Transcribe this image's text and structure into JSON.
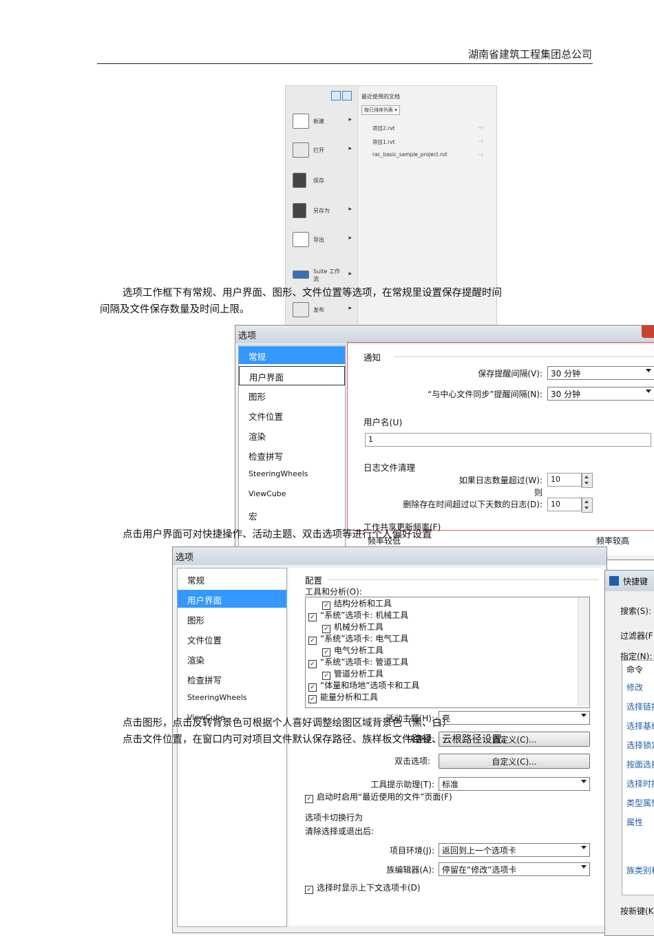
{
  "header": {
    "company": "湖南省建筑工程集团总公司"
  },
  "paragraphs": {
    "p1_line1": "选项工作框下有常规、用户界面、图形、文件位置等选项，在常规里设置保存提醒时间",
    "p1_line2": "间隔及文件保存数量及时间上限。",
    "p2": "点击用户界面可对快捷操作、活动主题、双击选项等进行个人偏好设置",
    "p3": "点击图形，点击反转背景色可根据个人喜好调整绘图区域背景色（黑、白）",
    "p4": "点击文件位置，在窗口内可对项目文件默认保存路径、族样板文件路径、云根路径设置。"
  },
  "app_menu": {
    "recent_title": "最近使用的文档",
    "sort_label": "按已排序列表",
    "items": [
      {
        "label": "新建",
        "arrow": "▸"
      },
      {
        "label": "打开",
        "arrow": "▸"
      },
      {
        "label": "保存",
        "arrow": ""
      },
      {
        "label": "另存为",
        "arrow": "▸"
      },
      {
        "label": "导出",
        "arrow": "▸"
      },
      {
        "label": "Suite 工作流",
        "arrow": "▸"
      },
      {
        "label": "发布",
        "arrow": "▸"
      }
    ],
    "recent_files": [
      "项目2.rvt",
      "项目1.rvt",
      "rac_basic_sample_project.rvt"
    ]
  },
  "dialog1": {
    "title": "选项",
    "sidebar": [
      "常规",
      "用户界面",
      "图形",
      "文件位置",
      "渲染",
      "检查拼写",
      "SteeringWheels",
      "ViewCube",
      "宏"
    ],
    "notify_group": "通知",
    "save_reminder_label": "保存提醒间隔(V):",
    "save_reminder_value": "30 分钟",
    "sync_reminder_label": "“与中心文件同步”提醒间隔(N):",
    "sync_reminder_value": "30 分钟",
    "username_group": "用户名(U)",
    "username_value": "1",
    "log_group": "日志文件清理",
    "log_count_label": "如果日志数量超过(W):",
    "log_count_value": "10",
    "then_label": "则",
    "log_days_label": "删除存在时间超过以下天数的日志(D):",
    "log_days_value": "10",
    "worksharing_group": "工作共享更新频率(F)",
    "freq_low": "频率较低",
    "freq_high": "频率较高"
  },
  "dialog2": {
    "title": "选项",
    "sidebar": [
      "常规",
      "用户界面",
      "图形",
      "文件位置",
      "渲染",
      "检查拼写",
      "SteeringWheels",
      "ViewCube"
    ],
    "config_group": "配置",
    "tools_label": "工具和分析(O):",
    "tree": [
      "结构分析和工具",
      "“系统”选项卡: 机械工具",
      "机械分析工具",
      "“系统”选项卡: 电气工具",
      "电气分析工具",
      "“系统”选项卡: 管道工具",
      "管道分析工具",
      "“体量和场地”选项卡和工具",
      "能量分析和工具"
    ],
    "theme_label": "活动主题(H):",
    "theme_value": "亮",
    "shortcut_label": "快捷键:",
    "shortcut_button": "自定义(C)...",
    "dblclick_label": "双击选项:",
    "dblclick_button": "自定义(C)...",
    "tooltip_label": "工具提示助理(T):",
    "tooltip_value": "标准",
    "recent_files_check": "启动时启用“最近使用的文件”页面(F)",
    "tab_group": "选项卡切换行为",
    "clear_label": "清除选择或退出后:",
    "project_env_label": "项目环境(J):",
    "project_env_value": "返回到上一个选项卡",
    "family_editor_label": "族编辑器(A):",
    "family_editor_value": "停留在“修改”选项卡",
    "context_tab_check": "选择时显示上下文选项卡(D)"
  },
  "dialog3": {
    "title": "快捷键",
    "search": "搜索(S):",
    "filter": "过滤器(F",
    "assign": "指定(N):",
    "col": "命令",
    "rows": [
      "修改",
      "选择链接",
      "选择基线",
      "选择锁定",
      "按面选择",
      "选择时拖",
      "类型属性",
      "属性",
      "",
      "族类别和"
    ],
    "presskey": "按新键(K"
  }
}
